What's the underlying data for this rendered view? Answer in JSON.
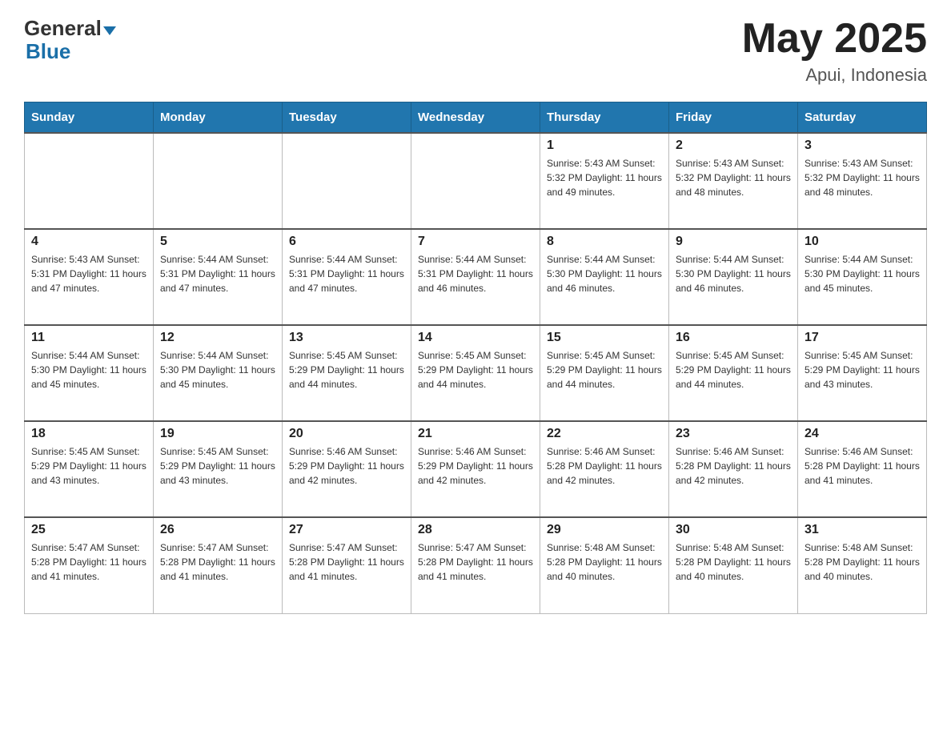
{
  "header": {
    "logo_general": "General",
    "logo_blue": "Blue",
    "month_title": "May 2025",
    "location": "Apui, Indonesia"
  },
  "calendar": {
    "days_of_week": [
      "Sunday",
      "Monday",
      "Tuesday",
      "Wednesday",
      "Thursday",
      "Friday",
      "Saturday"
    ],
    "weeks": [
      {
        "days": [
          {
            "num": "",
            "info": ""
          },
          {
            "num": "",
            "info": ""
          },
          {
            "num": "",
            "info": ""
          },
          {
            "num": "",
            "info": ""
          },
          {
            "num": "1",
            "info": "Sunrise: 5:43 AM\nSunset: 5:32 PM\nDaylight: 11 hours\nand 49 minutes."
          },
          {
            "num": "2",
            "info": "Sunrise: 5:43 AM\nSunset: 5:32 PM\nDaylight: 11 hours\nand 48 minutes."
          },
          {
            "num": "3",
            "info": "Sunrise: 5:43 AM\nSunset: 5:32 PM\nDaylight: 11 hours\nand 48 minutes."
          }
        ]
      },
      {
        "days": [
          {
            "num": "4",
            "info": "Sunrise: 5:43 AM\nSunset: 5:31 PM\nDaylight: 11 hours\nand 47 minutes."
          },
          {
            "num": "5",
            "info": "Sunrise: 5:44 AM\nSunset: 5:31 PM\nDaylight: 11 hours\nand 47 minutes."
          },
          {
            "num": "6",
            "info": "Sunrise: 5:44 AM\nSunset: 5:31 PM\nDaylight: 11 hours\nand 47 minutes."
          },
          {
            "num": "7",
            "info": "Sunrise: 5:44 AM\nSunset: 5:31 PM\nDaylight: 11 hours\nand 46 minutes."
          },
          {
            "num": "8",
            "info": "Sunrise: 5:44 AM\nSunset: 5:30 PM\nDaylight: 11 hours\nand 46 minutes."
          },
          {
            "num": "9",
            "info": "Sunrise: 5:44 AM\nSunset: 5:30 PM\nDaylight: 11 hours\nand 46 minutes."
          },
          {
            "num": "10",
            "info": "Sunrise: 5:44 AM\nSunset: 5:30 PM\nDaylight: 11 hours\nand 45 minutes."
          }
        ]
      },
      {
        "days": [
          {
            "num": "11",
            "info": "Sunrise: 5:44 AM\nSunset: 5:30 PM\nDaylight: 11 hours\nand 45 minutes."
          },
          {
            "num": "12",
            "info": "Sunrise: 5:44 AM\nSunset: 5:30 PM\nDaylight: 11 hours\nand 45 minutes."
          },
          {
            "num": "13",
            "info": "Sunrise: 5:45 AM\nSunset: 5:29 PM\nDaylight: 11 hours\nand 44 minutes."
          },
          {
            "num": "14",
            "info": "Sunrise: 5:45 AM\nSunset: 5:29 PM\nDaylight: 11 hours\nand 44 minutes."
          },
          {
            "num": "15",
            "info": "Sunrise: 5:45 AM\nSunset: 5:29 PM\nDaylight: 11 hours\nand 44 minutes."
          },
          {
            "num": "16",
            "info": "Sunrise: 5:45 AM\nSunset: 5:29 PM\nDaylight: 11 hours\nand 44 minutes."
          },
          {
            "num": "17",
            "info": "Sunrise: 5:45 AM\nSunset: 5:29 PM\nDaylight: 11 hours\nand 43 minutes."
          }
        ]
      },
      {
        "days": [
          {
            "num": "18",
            "info": "Sunrise: 5:45 AM\nSunset: 5:29 PM\nDaylight: 11 hours\nand 43 minutes."
          },
          {
            "num": "19",
            "info": "Sunrise: 5:45 AM\nSunset: 5:29 PM\nDaylight: 11 hours\nand 43 minutes."
          },
          {
            "num": "20",
            "info": "Sunrise: 5:46 AM\nSunset: 5:29 PM\nDaylight: 11 hours\nand 42 minutes."
          },
          {
            "num": "21",
            "info": "Sunrise: 5:46 AM\nSunset: 5:29 PM\nDaylight: 11 hours\nand 42 minutes."
          },
          {
            "num": "22",
            "info": "Sunrise: 5:46 AM\nSunset: 5:28 PM\nDaylight: 11 hours\nand 42 minutes."
          },
          {
            "num": "23",
            "info": "Sunrise: 5:46 AM\nSunset: 5:28 PM\nDaylight: 11 hours\nand 42 minutes."
          },
          {
            "num": "24",
            "info": "Sunrise: 5:46 AM\nSunset: 5:28 PM\nDaylight: 11 hours\nand 41 minutes."
          }
        ]
      },
      {
        "days": [
          {
            "num": "25",
            "info": "Sunrise: 5:47 AM\nSunset: 5:28 PM\nDaylight: 11 hours\nand 41 minutes."
          },
          {
            "num": "26",
            "info": "Sunrise: 5:47 AM\nSunset: 5:28 PM\nDaylight: 11 hours\nand 41 minutes."
          },
          {
            "num": "27",
            "info": "Sunrise: 5:47 AM\nSunset: 5:28 PM\nDaylight: 11 hours\nand 41 minutes."
          },
          {
            "num": "28",
            "info": "Sunrise: 5:47 AM\nSunset: 5:28 PM\nDaylight: 11 hours\nand 41 minutes."
          },
          {
            "num": "29",
            "info": "Sunrise: 5:48 AM\nSunset: 5:28 PM\nDaylight: 11 hours\nand 40 minutes."
          },
          {
            "num": "30",
            "info": "Sunrise: 5:48 AM\nSunset: 5:28 PM\nDaylight: 11 hours\nand 40 minutes."
          },
          {
            "num": "31",
            "info": "Sunrise: 5:48 AM\nSunset: 5:28 PM\nDaylight: 11 hours\nand 40 minutes."
          }
        ]
      }
    ]
  }
}
